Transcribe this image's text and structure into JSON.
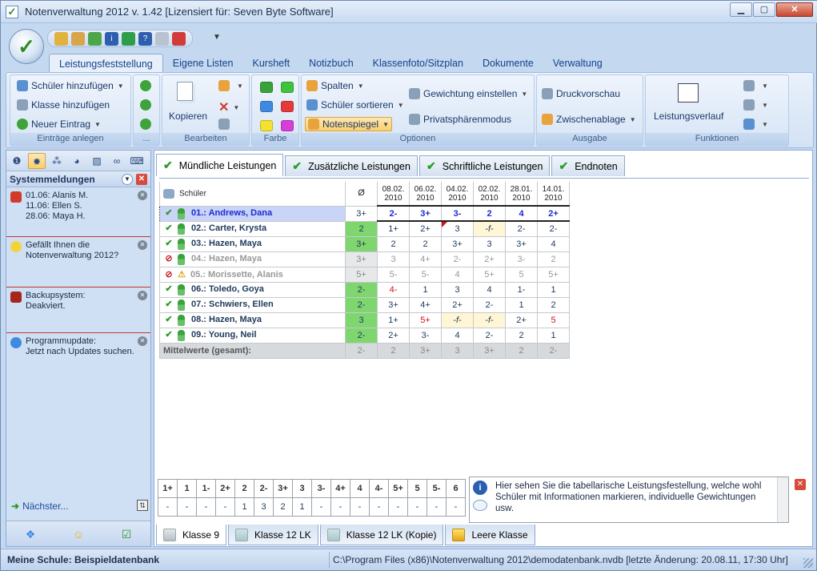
{
  "window": {
    "title": "Notenverwaltung 2012 v. 1.42   [Lizensiert für: Seven Byte Software]"
  },
  "ribbon_tabs": [
    "Leistungsfeststellung",
    "Eigene Listen",
    "Kursheft",
    "Notizbuch",
    "Klassenfoto/Sitzplan",
    "Dokumente",
    "Verwaltung"
  ],
  "groups": {
    "eintraege": {
      "label": "Einträge anlegen",
      "add_student": "Schüler hinzufügen",
      "add_class": "Klasse hinzufügen",
      "new_entry": "Neuer Eintrag"
    },
    "small": {
      "label": "..."
    },
    "bearbeiten": {
      "label": "Bearbeiten",
      "copy": "Kopieren"
    },
    "farbe": {
      "label": "Farbe"
    },
    "optionen": {
      "label": "Optionen",
      "spalten": "Spalten",
      "sort": "Schüler sortieren",
      "notenspiegel": "Notenspiegel",
      "gewichtung": "Gewichtung einstellen",
      "privat": "Privatsphärenmodus"
    },
    "ausgabe": {
      "label": "Ausgabe",
      "druck": "Druckvorschau",
      "clip": "Zwischenablage"
    },
    "funktionen": {
      "label": "Funktionen",
      "verlauf": "Leistungsverlauf"
    }
  },
  "colors": {
    "green": "#3ec43a",
    "red": "#e53a3a",
    "yellow": "#f4e02e",
    "magenta": "#d73ed8",
    "blue": "#3f8ae0",
    "darkgreen": "#1fa51f",
    "accent": "#2c9a2c"
  },
  "sidebar": {
    "title": "Systemmeldungen",
    "messages": [
      {
        "lines": [
          "01.06: Alanis M.",
          "11.06: Ellen S.",
          "28.06: Maya H."
        ]
      },
      {
        "lines": [
          "Gefällt Ihnen die",
          "Notenverwaltung 2012?"
        ]
      },
      {
        "lines": [
          "Backupsystem:",
          "Deakviert."
        ]
      },
      {
        "lines": [
          "Programmupdate:",
          "Jetzt nach Updates suchen."
        ]
      }
    ],
    "next": "Nächster..."
  },
  "content_tabs": [
    "Mündliche Leistungen",
    "Zusätzliche Leistungen",
    "Schriftliche Leistungen",
    "Endnoten"
  ],
  "grid": {
    "header": {
      "name": "Schüler",
      "avg": "Ø",
      "dates": [
        [
          "08.02.",
          "2010"
        ],
        [
          "06.02.",
          "2010"
        ],
        [
          "04.02.",
          "2010"
        ],
        [
          "02.02.",
          "2010"
        ],
        [
          "28.01.",
          "2010"
        ],
        [
          "14.01.",
          "2010"
        ]
      ]
    },
    "rows": [
      {
        "name": "01.:  Andrews, Dana",
        "avg": "3+",
        "grades": [
          "2-",
          "3+",
          "3-",
          "2",
          "4",
          "2+"
        ]
      },
      {
        "name": "02.:  Carter, Krysta",
        "avg": "2",
        "grades": [
          "1+",
          "2+",
          "3",
          "-f-",
          "2-",
          "2-"
        ]
      },
      {
        "name": "03.:  Hazen, Maya",
        "avg": "3+",
        "grades": [
          "2",
          "2",
          "3+",
          "3",
          "3+",
          "4"
        ]
      },
      {
        "name": "04.:  Hazen, Maya",
        "avg": "3+",
        "grades": [
          "3",
          "4+",
          "2-",
          "2+",
          "3-",
          "2"
        ]
      },
      {
        "name": "05.:  Morissette, Alanis",
        "avg": "5+",
        "grades": [
          "5-",
          "5-",
          "4",
          "5+",
          "5",
          "5+"
        ]
      },
      {
        "name": "06.:  Toledo, Goya",
        "avg": "2-",
        "grades": [
          "4-",
          "1",
          "3",
          "4",
          "1-",
          "1"
        ]
      },
      {
        "name": "07.:  Schwiers, Ellen",
        "avg": "2-",
        "grades": [
          "3+",
          "4+",
          "2+",
          "2-",
          "1",
          "2"
        ]
      },
      {
        "name": "08.:  Hazen, Maya",
        "avg": "3",
        "grades": [
          "1+",
          "5+",
          "-f-",
          "-f-",
          "2+",
          "5"
        ]
      },
      {
        "name": "09.:  Young, Neil",
        "avg": "2-",
        "grades": [
          "2+",
          "3-",
          "4",
          "2-",
          "2",
          "1"
        ]
      },
      {
        "name": "Mittelwerte (gesamt):",
        "avg": "2-",
        "grades": [
          "2",
          "3+",
          "3",
          "3+",
          "2",
          "2-"
        ]
      }
    ]
  },
  "scale": {
    "grades": [
      "1+",
      "1",
      "1-",
      "2+",
      "2",
      "2-",
      "3+",
      "3",
      "3-",
      "4+",
      "4",
      "4-",
      "5+",
      "5",
      "5-",
      "6"
    ],
    "counts": [
      "-",
      "-",
      "-",
      "-",
      "1",
      "3",
      "2",
      "1",
      "-",
      "-",
      "-",
      "-",
      "-",
      "-",
      "-",
      "-"
    ]
  },
  "info": "Hier sehen Sie die tabellarische Leistungsfestellung, welche wohl Schüler mit Informationen markieren, individuelle Gewichtungen usw.",
  "class_tabs": [
    "Klasse 9",
    "Klasse 12 LK",
    "Klasse 12 LK (Kopie)",
    "Leere Klasse"
  ],
  "status": {
    "left": "Meine Schule: Beispieldatenbank",
    "right": "C:\\Program Files (x86)\\Notenverwaltung 2012\\demodatenbank.nvdb  [letzte Änderung: 20.08.11, 17:30 Uhr]"
  }
}
